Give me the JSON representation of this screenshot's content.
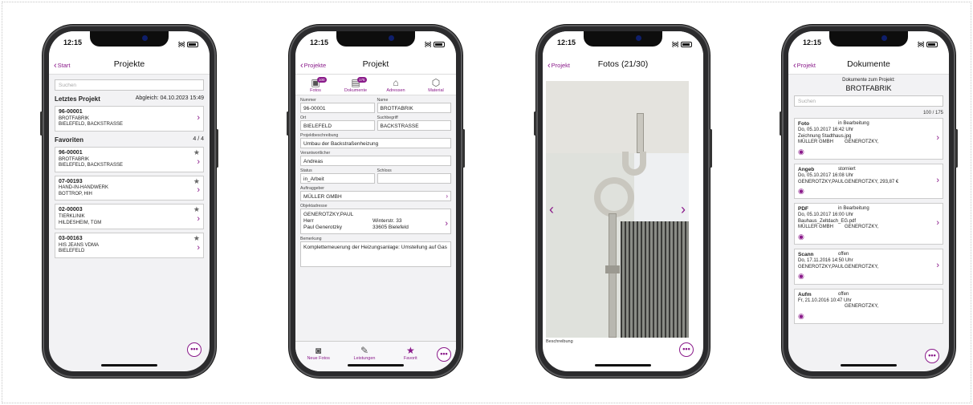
{
  "status_time": "12:15",
  "screens": {
    "projekte": {
      "back": "Start",
      "title": "Projekte",
      "search_placeholder": "Suchen",
      "last_header": "Letztes Projekt",
      "last_sync": "Abgleich: 04.10.2023 15:49",
      "last": {
        "nr": "96-00001",
        "name": "BROTFABRIK",
        "addr": "BIELEFELD, BACKSTRASSE"
      },
      "fav_header": "Favoriten",
      "fav_count": "4 / 4",
      "favorites": [
        {
          "nr": "96-00001",
          "name": "BROTFABRIK",
          "addr": "BIELEFELD, BACKSTRASSE"
        },
        {
          "nr": "07-00193",
          "name": "HAND-IN-HANDWERK",
          "addr": "BOTTROP, HIH"
        },
        {
          "nr": "02-00003",
          "name": "TIERKLINIK",
          "addr": "HILDESHEIM, TGM"
        },
        {
          "nr": "03-00163",
          "name": "HIS JEANS VDMA",
          "addr": "BIELEFELD"
        }
      ]
    },
    "projekt": {
      "back": "Projekte",
      "title": "Projekt",
      "icons": [
        {
          "label": "Fotos",
          "badge": "100",
          "icon": "photo-icon"
        },
        {
          "label": "Dokumente",
          "badge": "175",
          "icon": "document-icon"
        },
        {
          "label": "Adressen",
          "badge": "",
          "icon": "address-icon"
        },
        {
          "label": "Material",
          "badge": "",
          "icon": "material-icon"
        }
      ],
      "nummer_label": "Nummer",
      "nummer": "96-00001",
      "name_label": "Name",
      "name": "BROTFABRIK",
      "ort_label": "Ort",
      "ort": "BIELEFELD",
      "suchbegriff_label": "Suchbegriff",
      "suchbegriff": "BACKSTRASSE",
      "beschreibung_label": "Projektbeschreibung",
      "beschreibung": "Umbau der Backstraßenheizung",
      "verantwortlicher_label": "Verantwortlicher",
      "verantwortlicher": "Andreas",
      "status_label": "Status",
      "status": "in_Arbeit",
      "schloss_label": "Schloss",
      "schloss": "",
      "auftraggeber_label": "Auftraggeber",
      "auftraggeber": "MÜLLER GMBH",
      "objektadresse_label": "Objektadresse",
      "obj_line1": "GENEROTZKY,PAUL",
      "obj_line2a": "Herr",
      "obj_line2b": "Winterstr. 33",
      "obj_line3a": "Paul Generotzky",
      "obj_line3b": "33605 Bielefeld",
      "bemerkung_label": "Bemerkung",
      "bemerkung": "Komplettemeuerung der Heizungsanlage: Umstellung auf Gas",
      "tabs": [
        {
          "label": "Neue Fotos",
          "icon": "camera-icon"
        },
        {
          "label": "Leistungen",
          "icon": "pencil-icon"
        },
        {
          "label": "Favorit",
          "icon": "star-icon"
        }
      ]
    },
    "fotos": {
      "back": "Projekt",
      "title": "Fotos (21/30)",
      "desc_label": "Beschreibung"
    },
    "dokumente": {
      "back": "Projekt",
      "title": "Dokumente",
      "sub": "Dokumente zum Projekt:",
      "project": "BROTFABRIK",
      "search_placeholder": "Suchen",
      "count": "100 / 175",
      "docs": [
        {
          "type": "Foto",
          "state": "in Bearbeitung",
          "date": "Do, 05.10.2017 16:42 Uhr",
          "file": "Zeichnung Stadthaus.jpg",
          "a": "MÜLLER GMBH",
          "b": "GENEROTZKY,"
        },
        {
          "type": "Angeb",
          "state": "storniert",
          "date": "Do, 05.10.2017 16:08 Uhr",
          "file": "",
          "a": "GENEROTZKY,PAUL",
          "b": "GENEROTZKY,  293,87 €"
        },
        {
          "type": "PDF",
          "state": "in Bearbeitung",
          "date": "Do, 05.10.2017 16:00 Uhr",
          "file": "Bauhaus_Zeltdach_EG.pdf",
          "a": "MÜLLER GMBH",
          "b": "GENEROTZKY,"
        },
        {
          "type": "Scann",
          "state": "offen",
          "date": "Do, 17.11.2016 14:50 Uhr",
          "file": "",
          "a": "GENEROTZKY,PAUL",
          "b": "GENEROTZKY,"
        },
        {
          "type": "Aufm",
          "state": "offen",
          "date": "Fr, 21.10.2016 10:47 Uhr",
          "file": "",
          "a": "",
          "b": "GENEROTZKY,"
        }
      ]
    }
  },
  "colors": {
    "accent": "#8a1a8a",
    "background": "#f2f2f4"
  }
}
